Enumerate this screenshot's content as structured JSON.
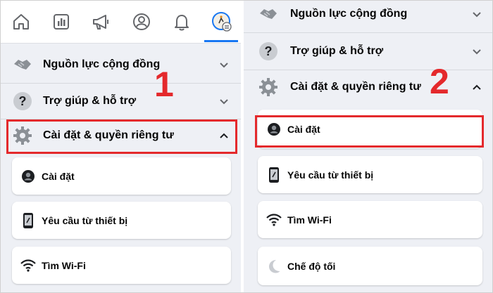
{
  "left": {
    "nav": {
      "icons": [
        "home-icon",
        "pages-icon",
        "megaphone-icon",
        "profile-icon",
        "bell-icon",
        "menu-avatar-icon"
      ],
      "active_color": "#1877f2"
    },
    "sections": {
      "community": {
        "label": "Nguồn lực cộng đồng",
        "icon": "handshake-icon"
      },
      "help": {
        "label": "Trợ giúp & hỗ trợ",
        "icon": "question-icon"
      },
      "settings": {
        "label": "Cài đặt & quyền riêng tư",
        "icon": "gear-icon"
      }
    },
    "items": [
      {
        "label": "Cài đặt",
        "icon": "person-circle-icon"
      },
      {
        "label": "Yêu cầu từ thiết bị",
        "icon": "phone-icon"
      },
      {
        "label": "Tìm Wi-Fi",
        "icon": "wifi-icon"
      }
    ],
    "step_number": "1"
  },
  "right": {
    "sections": {
      "community": {
        "label": "Nguồn lực cộng đồng",
        "icon": "handshake-icon"
      },
      "help": {
        "label": "Trợ giúp & hỗ trợ",
        "icon": "question-icon"
      },
      "settings": {
        "label": "Cài đặt & quyền riêng tư",
        "icon": "gear-icon"
      }
    },
    "items": [
      {
        "label": "Cài đặt",
        "icon": "person-circle-icon"
      },
      {
        "label": "Yêu cầu từ thiết bị",
        "icon": "phone-icon"
      },
      {
        "label": "Tìm Wi-Fi",
        "icon": "wifi-icon"
      },
      {
        "label": "Chế độ tối",
        "icon": "moon-icon"
      }
    ],
    "step_number": "2"
  },
  "colors": {
    "highlight": "#e4292c",
    "accent": "#1877f2",
    "background": "#eef0f5"
  }
}
